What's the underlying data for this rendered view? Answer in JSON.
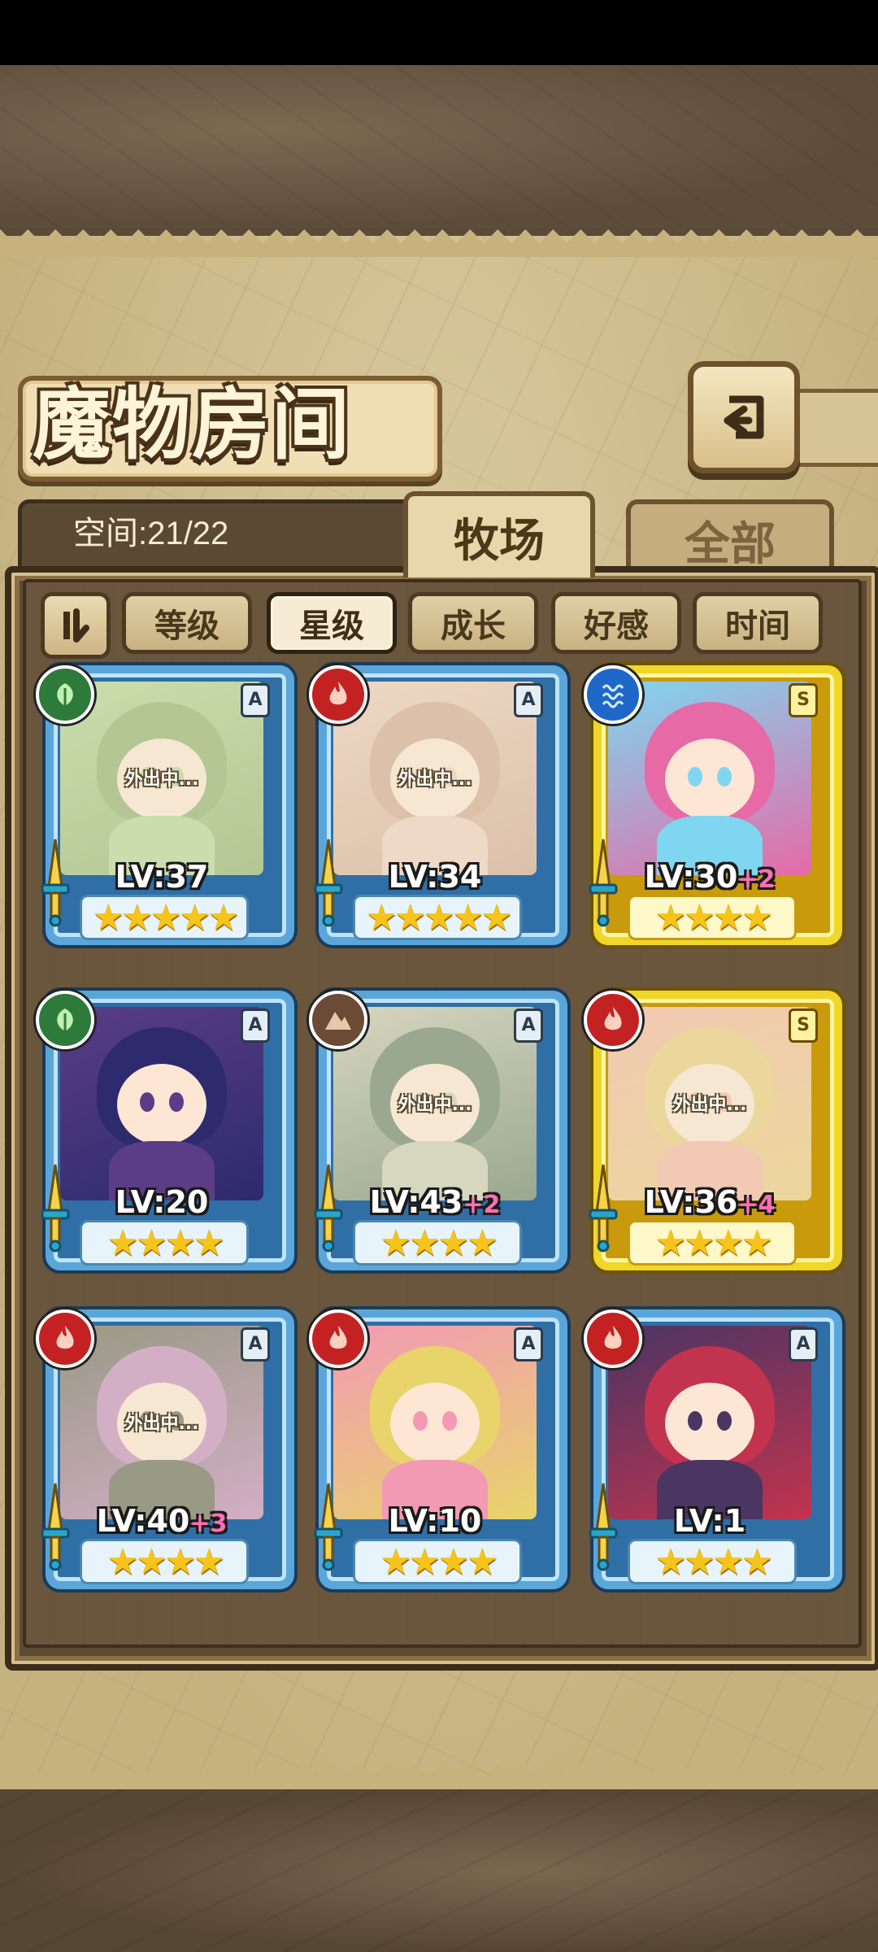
{
  "header": {
    "title": "魔物房间",
    "back_icon": "return-arrow-icon"
  },
  "space": {
    "label": "空间:21/22"
  },
  "tabs": [
    {
      "label": "牧场",
      "active": true
    },
    {
      "label": "全部",
      "active": false
    }
  ],
  "filters": [
    {
      "label": "等级",
      "active": false
    },
    {
      "label": "星级",
      "active": true
    },
    {
      "label": "成长",
      "active": false
    },
    {
      "label": "好感",
      "active": false
    },
    {
      "label": "时间",
      "active": false
    }
  ],
  "cards": [
    {
      "element": "grass",
      "rank": "A",
      "level": "LV:37",
      "plus": "",
      "stars": "★★★★★",
      "status": "外出中...",
      "frame": "blue"
    },
    {
      "element": "fire",
      "rank": "A",
      "level": "LV:34",
      "plus": "",
      "stars": "★★★★★",
      "status": "外出中...",
      "frame": "blue"
    },
    {
      "element": "water",
      "rank": "S",
      "level": "LV:30",
      "plus": "+2",
      "stars": "★★★★",
      "status": "",
      "frame": "gold"
    },
    {
      "element": "grass",
      "rank": "A",
      "level": "LV:20",
      "plus": "",
      "stars": "★★★★",
      "status": "",
      "frame": "blue"
    },
    {
      "element": "earth",
      "rank": "A",
      "level": "LV:43",
      "plus": "+2",
      "stars": "★★★★",
      "status": "外出中...",
      "frame": "blue"
    },
    {
      "element": "fire",
      "rank": "S",
      "level": "LV:36",
      "plus": "+4",
      "stars": "★★★★",
      "status": "外出中...",
      "frame": "gold"
    },
    {
      "element": "fire",
      "rank": "A",
      "level": "LV:40",
      "plus": "+3",
      "stars": "★★★★",
      "status": "外出中...",
      "frame": "blue"
    },
    {
      "element": "fire",
      "rank": "A",
      "level": "LV:10",
      "plus": "",
      "stars": "★★★★",
      "status": "",
      "frame": "blue"
    },
    {
      "element": "fire",
      "rank": "A",
      "level": "LV:1",
      "plus": "",
      "stars": "★★★★",
      "status": "",
      "frame": "blue"
    }
  ],
  "colors": {
    "parchment": "#c6b27f",
    "panel": "#6a563c",
    "blue_frame": "#5aa6da",
    "gold_frame": "#f1d62a",
    "level_plus": "#ff6fb3"
  }
}
